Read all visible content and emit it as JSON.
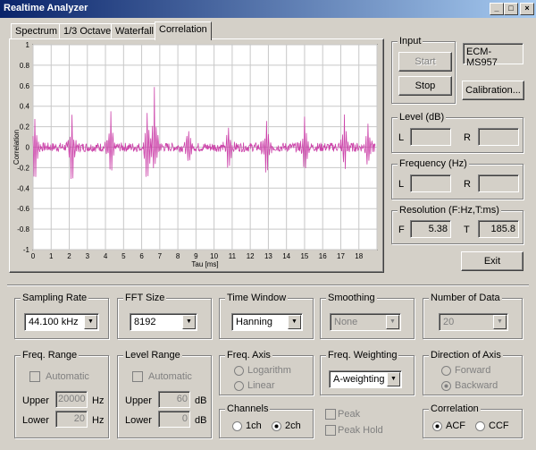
{
  "window": {
    "title": "Realtime Analyzer",
    "min": "_",
    "max": "□",
    "close": "×"
  },
  "tabs": [
    "Spectrum",
    "1/3 Octave",
    "Waterfall",
    "Correlation"
  ],
  "chart_data": {
    "type": "line",
    "ylabel": "Correlation",
    "xlabel": "Tau [ms]",
    "xlim": [
      0,
      19
    ],
    "ylim": [
      -1,
      1
    ],
    "x_ticks": [
      "0",
      "1",
      "2",
      "3",
      "4",
      "5",
      "6",
      "7",
      "8",
      "9",
      "10",
      "11",
      "12",
      "13",
      "14",
      "15",
      "16",
      "17",
      "18"
    ],
    "y_ticks": [
      "1",
      "0.8",
      "0.6",
      "0.4",
      "0.2",
      "0",
      "-0.2",
      "-0.4",
      "-0.6",
      "-0.8",
      "-1"
    ],
    "series": [
      {
        "color": "#cc44aa",
        "peaks": [
          {
            "x": 0.1,
            "up": 0.28,
            "dn": -0.4
          },
          {
            "x": 2.15,
            "up": 0.3,
            "dn": -0.45
          },
          {
            "x": 4.3,
            "up": 0.35,
            "dn": -0.4
          },
          {
            "x": 6.3,
            "up": 0.3,
            "dn": -0.42
          },
          {
            "x": 6.7,
            "up": 0.55,
            "dn": -0.3
          },
          {
            "x": 8.6,
            "up": 0.2,
            "dn": -0.22
          },
          {
            "x": 10.8,
            "up": 0.22,
            "dn": -0.3
          },
          {
            "x": 12.9,
            "up": 0.25,
            "dn": -0.4
          },
          {
            "x": 15.0,
            "up": 0.3,
            "dn": -0.35
          },
          {
            "x": 17.2,
            "up": 0.3,
            "dn": -0.28
          },
          {
            "x": 18.5,
            "up": 0.25,
            "dn": -0.2
          }
        ]
      }
    ],
    "grid": true
  },
  "input": {
    "label": "Input",
    "start": "Start",
    "stop": "Stop",
    "device": "ECM-MS957",
    "calibration": "Calibration..."
  },
  "level": {
    "label": "Level (dB)",
    "l": "L",
    "r": "R"
  },
  "frequency": {
    "label": "Frequency (Hz)",
    "l": "L",
    "r": "R"
  },
  "resolution": {
    "label": "Resolution (F:Hz,T:ms)",
    "f": "F",
    "f_val": "5.38",
    "t": "T",
    "t_val": "185.8"
  },
  "exit": "Exit",
  "sampling": {
    "label": "Sampling Rate",
    "value": "44.100 kHz"
  },
  "fft": {
    "label": "FFT Size",
    "value": "8192"
  },
  "timewin": {
    "label": "Time Window",
    "value": "Hanning"
  },
  "smoothing": {
    "label": "Smoothing",
    "value": "None"
  },
  "numdata": {
    "label": "Number of Data",
    "value": "20"
  },
  "freqrange": {
    "label": "Freq. Range",
    "auto": "Automatic",
    "upper": "Upper",
    "upper_val": "20000",
    "upper_unit": "Hz",
    "lower": "Lower",
    "lower_val": "20",
    "lower_unit": "Hz"
  },
  "levelrange": {
    "label": "Level Range",
    "auto": "Automatic",
    "upper": "Upper",
    "upper_val": "60",
    "upper_unit": "dB",
    "lower": "Lower",
    "lower_val": "0",
    "lower_unit": "dB"
  },
  "freqaxis": {
    "label": "Freq. Axis",
    "log": "Logarithm",
    "lin": "Linear"
  },
  "freqweight": {
    "label": "Freq. Weighting",
    "value": "A-weighting"
  },
  "direction": {
    "label": "Direction of Axis",
    "fwd": "Forward",
    "bwd": "Backward"
  },
  "channels": {
    "label": "Channels",
    "ch1": "1ch",
    "ch2": "2ch"
  },
  "peak": {
    "peak": "Peak",
    "hold": "Peak Hold"
  },
  "correlation": {
    "label": "Correlation",
    "acf": "ACF",
    "ccf": "CCF"
  }
}
